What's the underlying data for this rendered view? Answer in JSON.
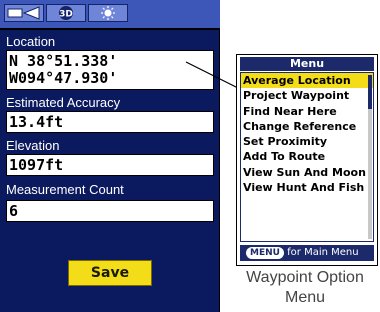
{
  "toolbar": {
    "icons": [
      "backlight-icon",
      "3d-view-icon",
      "brightness-icon"
    ],
    "mode_label": "3D"
  },
  "location": {
    "label": "Location",
    "lat": "N  38°51.338'",
    "lon": "W094°47.930'"
  },
  "accuracy": {
    "label": "Estimated Accuracy",
    "value": "13.4ft"
  },
  "elevation": {
    "label": "Elevation",
    "value": "1097ft"
  },
  "measurement": {
    "label": "Measurement Count",
    "value": "6"
  },
  "save_label": "Save",
  "menu": {
    "title": "Menu",
    "items": [
      "Average Location",
      "Project Waypoint",
      "Find Near Here",
      "Change Reference",
      "Set Proximity",
      "Add To Route",
      "View Sun And Moon",
      "View Hunt And Fish"
    ],
    "selected_index": 0,
    "footer_key": "MENU",
    "footer_text": "for Main Menu"
  },
  "caption": "Waypoint Option Menu",
  "colors": {
    "screen_bg": "#0b1a5e",
    "highlight": "#f3dd18",
    "menu_header": "#1c2a6b"
  }
}
